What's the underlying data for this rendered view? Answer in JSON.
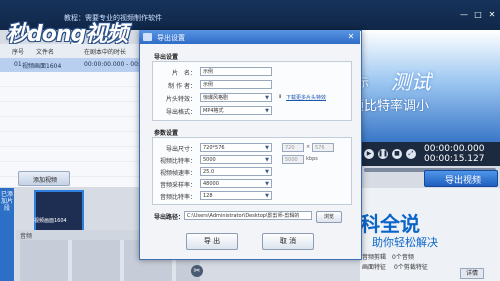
{
  "app": {
    "brand": "秒dong视频",
    "title": "教程：需要专业的视频制作软件",
    "window_buttons": [
      "—",
      "□",
      "✕"
    ]
  },
  "list": {
    "headers": [
      "序号",
      "文件名",
      "在剧本中的时长"
    ],
    "rows": [
      {
        "index": "01",
        "name": "视频画面1604",
        "duration": "00:00:00.000 - 00:00:04"
      }
    ]
  },
  "bottom": {
    "sidebar_label": "已添加片段",
    "add_video": "添加视频",
    "clip_name": "视频画面1604",
    "track_label": "音频"
  },
  "preview": {
    "watermark_small": "小提示",
    "watermark_big": "测试",
    "watermark_line": "视频比特率调小",
    "time_current": "00:00:00.000",
    "time_total": "00:00:15.127",
    "export_button": "导出视频",
    "stamp_main": "百科全说",
    "stamp_sub": "助你轻松解决",
    "info_label": "画面特征",
    "info_value": "0个剪裁特征",
    "detail_button": "详情",
    "info_label2": "音频剪辑",
    "info_value2": "0个音频"
  },
  "dialog": {
    "title": "导出设置",
    "close": "✕",
    "basic": {
      "heading": "导出设置",
      "name_label": "片　名：",
      "name_value": "示例",
      "author_label": "制 作 者：",
      "author_value": "示例",
      "credits_label": "片头特效：",
      "credits_value": "惊爆风格剧",
      "download_link": "下载更多片头特效",
      "format_label": "导出格式：",
      "format_value": "MP4格式"
    },
    "params": {
      "heading": "参数设置",
      "size_label": "导出尺寸：",
      "size_value": "720*576",
      "width_value": "720",
      "height_value": "576",
      "bitrate_label": "视频比特率：",
      "bitrate_value": "5000",
      "bitrate_input": "5000",
      "bitrate_unit": "kbps",
      "fps_label": "视频帧速率：",
      "fps_value": "25.0",
      "samplerate_label": "音频采样率：",
      "samplerate_value": "48000",
      "audiobitrate_label": "音频比特率：",
      "audiobitrate_value": "128"
    },
    "path_label": "导出路径：",
    "path_value": "C:\\Users\\Administrator\\Desktop\\影剪师-剪辑的",
    "browse_button": "浏览",
    "export_button": "导 出",
    "cancel_button": "取 消"
  }
}
